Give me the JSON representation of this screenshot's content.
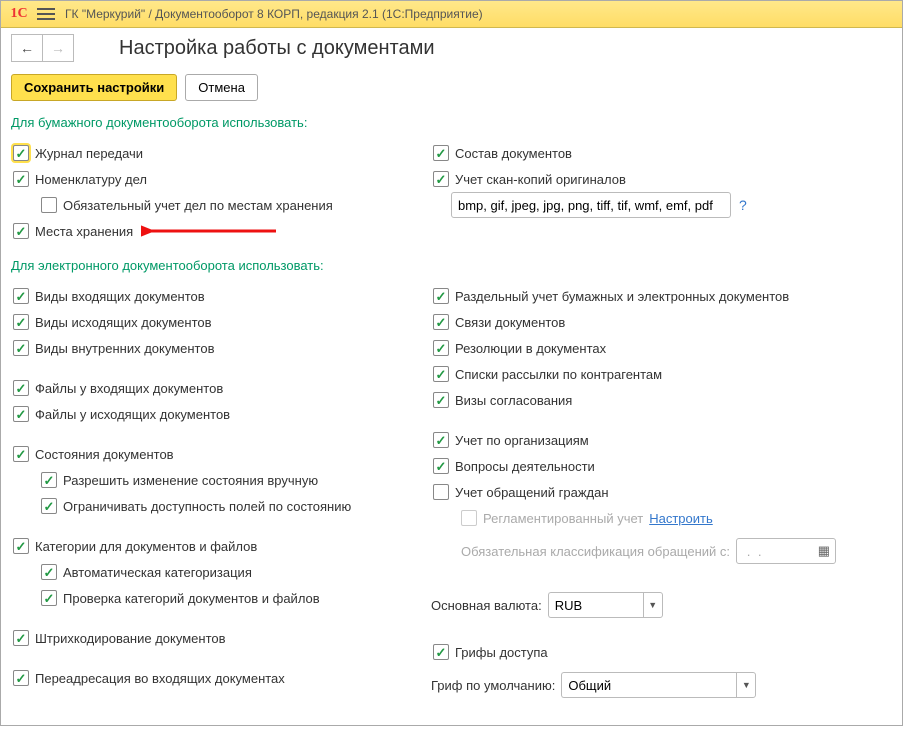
{
  "title_bar": "ГК \"Меркурий\" / Документооборот 8 КОРП, редакция 2.1  (1С:Предприятие)",
  "page_title": "Настройка работы с документами",
  "buttons": {
    "save": "Сохранить настройки",
    "cancel": "Отмена"
  },
  "sections": {
    "paper": "Для бумажного документооборота использовать:",
    "electronic": "Для электронного документооборота использовать:"
  },
  "paper_left": {
    "journal": "Журнал передачи",
    "nomenclature": "Номенклатуру дел",
    "mandatory_storage": "Обязательный учет дел по местам хранения",
    "storage_places": "Места хранения"
  },
  "paper_right": {
    "doc_composition": "Состав документов",
    "scan_copies": "Учет скан-копий оригиналов",
    "formats_value": "bmp, gif, jpeg, jpg, png, tiff, tif, wmf, emf, pdf",
    "help": "?"
  },
  "elec_left": {
    "incoming_types": "Виды входящих документов",
    "outgoing_types": "Виды исходящих документов",
    "internal_types": "Виды внутренних документов",
    "files_incoming": "Файлы у входящих документов",
    "files_outgoing": "Файлы у исходящих документов",
    "doc_states": "Состояния документов",
    "state_manual": "Разрешить изменение состояния вручную",
    "state_restrict": "Ограничивать доступность полей по состоянию",
    "categories": "Категории для документов и файлов",
    "auto_cat": "Автоматическая категоризация",
    "check_cat": "Проверка категорий документов и файлов",
    "barcode": "Штрихкодирование документов",
    "redirect": "Переадресация во входящих документах"
  },
  "elec_right": {
    "split_paper_elec": "Раздельный учет бумажных и электронных документов",
    "doc_links": "Связи документов",
    "resolutions": "Резолюции в документах",
    "mailing_lists": "Списки рассылки по контрагентам",
    "approval_visas": "Визы согласования",
    "by_org": "Учет по организациям",
    "activity_q": "Вопросы деятельности",
    "citizen_appeals": "Учет обращений граждан",
    "reg_acc": "Регламентированный учет",
    "reg_acc_link": "Настроить",
    "mandatory_classification": "Обязательная классификация обращений с:",
    "date_placeholder": " .  . ",
    "main_currency_label": "Основная валюта:",
    "main_currency_value": "RUB",
    "access_stamps": "Грифы доступа",
    "default_stamp_label": "Гриф по умолчанию:",
    "default_stamp_value": "Общий"
  }
}
